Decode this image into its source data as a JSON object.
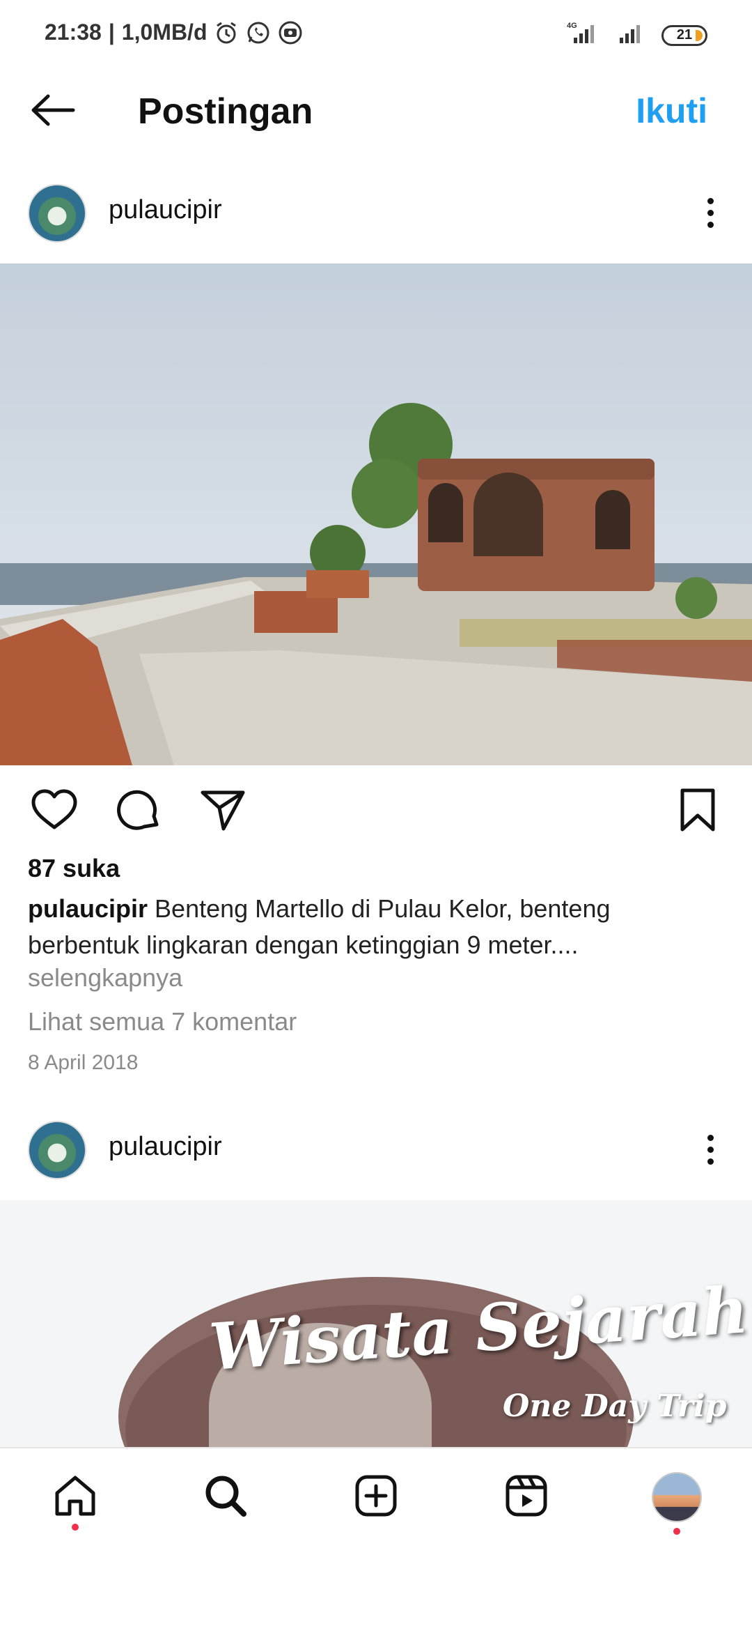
{
  "status_bar": {
    "time": "21:38",
    "data_rate": "1,0MB/d",
    "network": "4G",
    "battery": "21",
    "icons": [
      "alarm-icon",
      "whatsapp-icon",
      "screen-record-icon",
      "signal-icon",
      "battery-icon"
    ]
  },
  "header": {
    "title": "Postingan",
    "follow_label": "Ikuti",
    "back_icon": "arrow-left-icon"
  },
  "post": {
    "username": "pulaucipir",
    "likes": "87 suka",
    "caption_user": "pulaucipir",
    "caption_text": "Benteng Martello di Pulau Kelor, benteng berbentuk lingkaran dengan ketinggian 9 meter....",
    "more_label": "selengkapnya",
    "comments_label": "Lihat semua 7 komentar",
    "date": "8 April 2018",
    "action_icons": [
      "heart-icon",
      "comment-icon",
      "share-icon",
      "bookmark-icon"
    ]
  },
  "post2": {
    "username": "pulaucipir",
    "image_title": "Wisata Sejarah",
    "image_subtitle": "One Day Trip"
  },
  "bottom_nav": {
    "items": [
      "home-icon",
      "search-icon",
      "create-icon",
      "reels-icon",
      "profile-avatar"
    ]
  },
  "colors": {
    "accent": "#1e9ff2",
    "muted_text": "#8a8a8a",
    "notification_dot": "#f0304a"
  }
}
